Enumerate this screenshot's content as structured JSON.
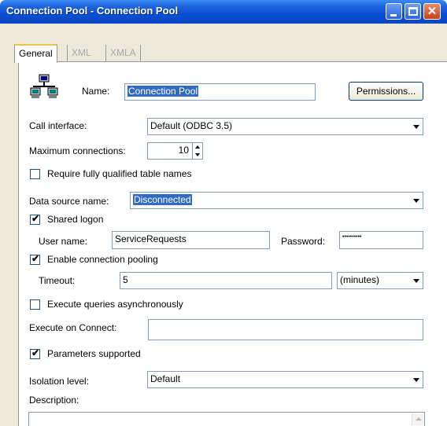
{
  "window": {
    "title": "Connection Pool - Connection Pool",
    "close_glyph": "✕"
  },
  "tabs": [
    {
      "label": "General",
      "active": true
    },
    {
      "label": "XML",
      "active": false
    },
    {
      "label": "XMLA",
      "active": false
    }
  ],
  "form": {
    "name_label": "Name:",
    "name_value": "Connection Pool",
    "permissions_button": "Permissions...",
    "call_interface_label": "Call interface:",
    "call_interface_value": "Default (ODBC 3.5)",
    "max_connections_label": "Maximum connections:",
    "max_connections_value": "10",
    "require_fq_label": "Require fully qualified table names",
    "require_fq_checked": false,
    "dsn_label": "Data source name:",
    "dsn_value": "Disconnected",
    "shared_logon_label": "Shared logon",
    "shared_logon_checked": true,
    "username_label": "User name:",
    "username_value": "ServiceRequests",
    "password_label": "Password:",
    "password_value": "••••••••••",
    "pooling_label": "Enable connection pooling",
    "pooling_checked": true,
    "timeout_label": "Timeout:",
    "timeout_value": "5",
    "timeout_unit": "(minutes)",
    "async_label": "Execute queries asynchronously",
    "async_checked": false,
    "exec_on_connect_label": "Execute on Connect:",
    "exec_on_connect_value": "",
    "params_label": "Parameters supported",
    "params_checked": true,
    "isolation_label": "Isolation level:",
    "isolation_value": "Default",
    "description_label": "Description:",
    "description_value": ""
  },
  "icons": {
    "check_mark": "✔"
  }
}
